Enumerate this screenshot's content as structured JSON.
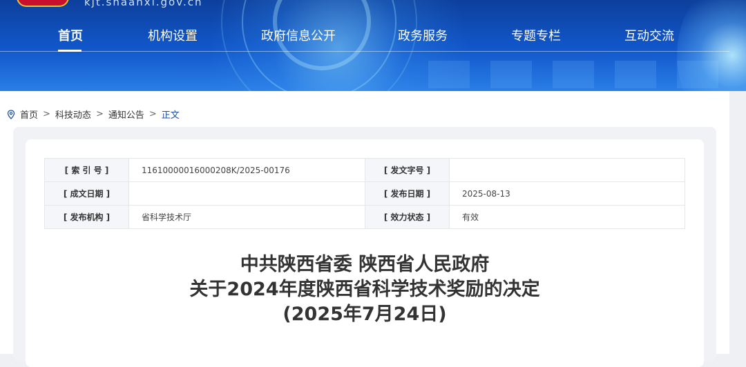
{
  "site": {
    "domain": "kjt.shaanxi.gov.cn",
    "colors": {
      "header_blue": "#1158cc",
      "link_blue": "#1a4fa0",
      "status_green": "#1a9a3a"
    }
  },
  "nav": {
    "items": [
      {
        "label": "首页",
        "active": true
      },
      {
        "label": "机构设置"
      },
      {
        "label": "政府信息公开"
      },
      {
        "label": "政务服务"
      },
      {
        "label": "专题专栏"
      },
      {
        "label": "互动交流"
      }
    ]
  },
  "breadcrumb": {
    "icon": "location-pin-icon",
    "items": [
      "首页",
      "科技动态",
      "通知公告"
    ],
    "current": "正文",
    "separator": ">"
  },
  "meta": {
    "rows": [
      {
        "k1": "[ 索 引 号 ]",
        "v1": "11610000016000208K/2025-00176",
        "k2": "[ 发文字号 ]",
        "v2": ""
      },
      {
        "k1": "[ 成文日期 ]",
        "v1": "",
        "k2": "[ 发布日期 ]",
        "v2": "2025-08-13"
      },
      {
        "k1": "[ 发布机构 ]",
        "v1": "省科学技术厅",
        "k2": "[ 效力状态 ]",
        "v2": "有效"
      }
    ]
  },
  "article": {
    "title_line1": "中共陕西省委 陕西省人民政府",
    "title_line2": "关于2024年度陕西省科学技术奖励的决定",
    "title_line3": "(2025年7月24日)"
  }
}
